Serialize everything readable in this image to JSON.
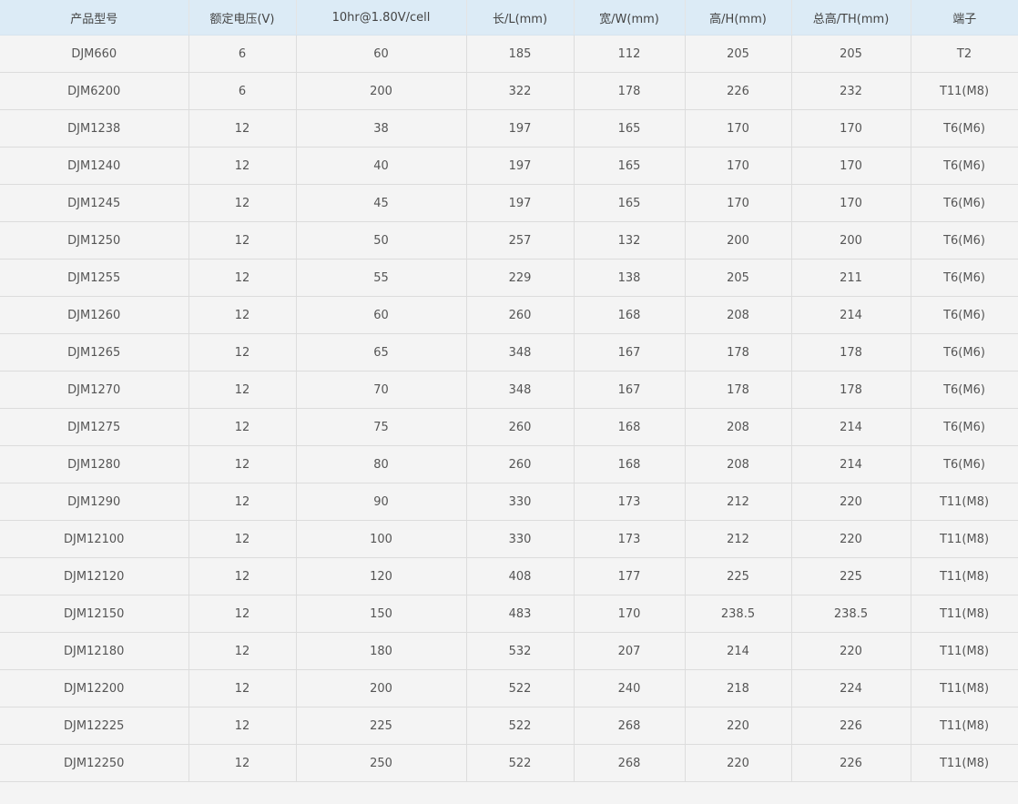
{
  "table": {
    "headers": [
      "产品型号",
      "额定电压(V)",
      "10hr@1.80V/cell",
      "长/L(mm)",
      "宽/W(mm)",
      "高/H(mm)",
      "总高/TH(mm)",
      "端子"
    ],
    "rows": [
      [
        "DJM660",
        "6",
        "60",
        "185",
        "112",
        "205",
        "205",
        "T2"
      ],
      [
        "DJM6200",
        "6",
        "200",
        "322",
        "178",
        "226",
        "232",
        "T11(M8)"
      ],
      [
        "DJM1238",
        "12",
        "38",
        "197",
        "165",
        "170",
        "170",
        "T6(M6)"
      ],
      [
        "DJM1240",
        "12",
        "40",
        "197",
        "165",
        "170",
        "170",
        "T6(M6)"
      ],
      [
        "DJM1245",
        "12",
        "45",
        "197",
        "165",
        "170",
        "170",
        "T6(M6)"
      ],
      [
        "DJM1250",
        "12",
        "50",
        "257",
        "132",
        "200",
        "200",
        "T6(M6)"
      ],
      [
        "DJM1255",
        "12",
        "55",
        "229",
        "138",
        "205",
        "211",
        "T6(M6)"
      ],
      [
        "DJM1260",
        "12",
        "60",
        "260",
        "168",
        "208",
        "214",
        "T6(M6)"
      ],
      [
        "DJM1265",
        "12",
        "65",
        "348",
        "167",
        "178",
        "178",
        "T6(M6)"
      ],
      [
        "DJM1270",
        "12",
        "70",
        "348",
        "167",
        "178",
        "178",
        "T6(M6)"
      ],
      [
        "DJM1275",
        "12",
        "75",
        "260",
        "168",
        "208",
        "214",
        "T6(M6)"
      ],
      [
        "DJM1280",
        "12",
        "80",
        "260",
        "168",
        "208",
        "214",
        "T6(M6)"
      ],
      [
        "DJM1290",
        "12",
        "90",
        "330",
        "173",
        "212",
        "220",
        "T11(M8)"
      ],
      [
        "DJM12100",
        "12",
        "100",
        "330",
        "173",
        "212",
        "220",
        "T11(M8)"
      ],
      [
        "DJM12120",
        "12",
        "120",
        "408",
        "177",
        "225",
        "225",
        "T11(M8)"
      ],
      [
        "DJM12150",
        "12",
        "150",
        "483",
        "170",
        "238.5",
        "238.5",
        "T11(M8)"
      ],
      [
        "DJM12180",
        "12",
        "180",
        "532",
        "207",
        "214",
        "220",
        "T11(M8)"
      ],
      [
        "DJM12200",
        "12",
        "200",
        "522",
        "240",
        "218",
        "224",
        "T11(M8)"
      ],
      [
        "DJM12225",
        "12",
        "225",
        "522",
        "268",
        "220",
        "226",
        "T11(M8)"
      ],
      [
        "DJM12250",
        "12",
        "250",
        "522",
        "268",
        "220",
        "226",
        "T11(M8)"
      ]
    ]
  },
  "colors": {
    "header_bg": "#dcebf6",
    "body_bg": "#f4f4f4",
    "text": "#555555",
    "grid": "#dddddd"
  }
}
